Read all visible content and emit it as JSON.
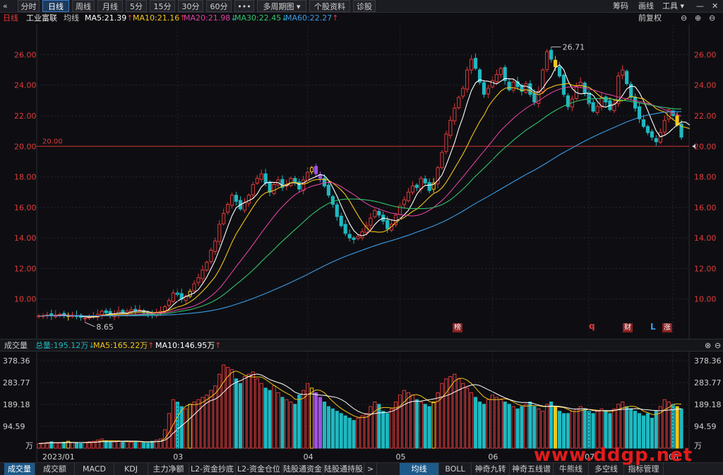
{
  "toolbar": {
    "back_icon": "«",
    "tabs": [
      {
        "label": "分时"
      },
      {
        "label": "日线"
      },
      {
        "label": "周线"
      },
      {
        "label": "月线"
      },
      {
        "label": "5分"
      },
      {
        "label": "15分"
      },
      {
        "label": "30分"
      },
      {
        "label": "60分"
      },
      {
        "label": "•••"
      },
      {
        "label": "多周期图"
      },
      {
        "label": "个股资料"
      },
      {
        "label": "诊股"
      }
    ],
    "active_tab": "日线",
    "right": {
      "chips": "筹码",
      "draw": "画线",
      "tools": "工具"
    }
  },
  "indicator": {
    "period": "日线",
    "name": "工业富联",
    "ma_label": "均线",
    "ma5": "MA5:21.39",
    "ma10": "MA10:21.16",
    "ma20": "MA20:21.98",
    "ma30": "MA30:22.45",
    "ma60": "MA60:22.27",
    "adjust": "前复权"
  },
  "colors": {
    "up": "#e03a3a",
    "down": "#1fb8c0",
    "ma5": "#ffffff",
    "ma10": "#f5c518",
    "ma20": "#e040a0",
    "ma30": "#33c36b",
    "ma60": "#3a9be8",
    "grid": "#262830",
    "accent": "#3b78c2"
  },
  "markers": {
    "bang": "榜",
    "q": "q",
    "cai": "财",
    "L": "L",
    "zhang": "涨"
  },
  "chart_data": [
    {
      "type": "candlestick",
      "y_ticks": [
        "26.00",
        "24.00",
        "22.00",
        "20.00",
        "18.00",
        "16.00",
        "14.00",
        "12.00",
        "10.00"
      ],
      "ylim": [
        8.0,
        27.5
      ],
      "x_labels": [
        "03",
        "04",
        "05",
        "06",
        "07",
        "08"
      ],
      "high_annotation": "26.71",
      "low_annotation": "8.65",
      "hline_label": "20.00",
      "hline_value": 20.0,
      "closes": [
        8.9,
        8.9,
        8.95,
        8.9,
        8.95,
        9.0,
        8.95,
        8.9,
        8.9,
        8.85,
        8.8,
        8.75,
        8.8,
        8.9,
        9.0,
        9.2,
        9.1,
        8.9,
        9.0,
        9.2,
        9.1,
        9.2,
        9.3,
        9.2,
        9.3,
        9.1,
        9.0,
        9.0,
        9.1,
        9.2,
        9.5,
        9.9,
        10.4,
        10.3,
        10.0,
        10.2,
        10.5,
        11.0,
        11.4,
        11.9,
        12.4,
        13.2,
        13.8,
        14.9,
        15.6,
        16.2,
        16.8,
        16.4,
        15.9,
        16.3,
        16.8,
        17.5,
        17.9,
        18.2,
        17.6,
        17.0,
        17.5,
        17.8,
        17.3,
        17.5,
        17.9,
        17.6,
        17.2,
        17.8,
        18.3,
        18.6,
        18.2,
        17.9,
        17.4,
        16.8,
        16.2,
        15.4,
        14.8,
        14.3,
        14.0,
        13.9,
        14.1,
        14.4,
        14.8,
        15.3,
        15.8,
        15.5,
        15.1,
        14.6,
        14.9,
        15.5,
        16.1,
        16.5,
        17.0,
        17.4,
        17.3,
        17.9,
        17.6,
        17.1,
        17.6,
        18.6,
        19.6,
        20.8,
        21.7,
        22.5,
        23.2,
        23.8,
        25.0,
        25.7,
        25.1,
        24.2,
        23.4,
        23.8,
        24.3,
        24.7,
        25.1,
        24.3,
        23.7,
        24.2,
        23.9,
        23.6,
        24.1,
        23.4,
        22.9,
        23.6,
        25.0,
        26.2,
        25.7,
        25.2,
        24.6,
        23.4,
        22.6,
        23.1,
        23.9,
        24.2,
        23.5,
        22.8,
        22.3,
        22.6,
        23.2,
        22.9,
        22.4,
        22.8,
        24.6,
        25.0,
        24.1,
        23.2,
        22.5,
        21.8,
        21.3,
        20.9,
        20.6,
        20.3,
        20.9,
        21.7,
        22.4,
        22.0,
        21.4,
        20.6
      ],
      "volumes": [
        20,
        22,
        25,
        28,
        24,
        22,
        26,
        30,
        24,
        22,
        20,
        25,
        28,
        30,
        35,
        40,
        30,
        26,
        28,
        32,
        30,
        28,
        26,
        30,
        28,
        24,
        22,
        30,
        35,
        40,
        80,
        150,
        210,
        200,
        180,
        170,
        190,
        200,
        210,
        220,
        230,
        250,
        270,
        320,
        360,
        350,
        340,
        300,
        280,
        310,
        320,
        330,
        300,
        280,
        260,
        250,
        270,
        240,
        220,
        210,
        200,
        190,
        230,
        250,
        280,
        260,
        240,
        220,
        200,
        180,
        170,
        160,
        150,
        140,
        130,
        120,
        130,
        140,
        150,
        180,
        200,
        190,
        160,
        150,
        170,
        200,
        230,
        250,
        240,
        230,
        210,
        200,
        190,
        180,
        200,
        240,
        280,
        300,
        310,
        320,
        300,
        280,
        260,
        240,
        220,
        200,
        190,
        210,
        230,
        220,
        210,
        200,
        190,
        180,
        170,
        180,
        190,
        200,
        180,
        170,
        160,
        190,
        200,
        180,
        160,
        150,
        150,
        160,
        170,
        180,
        170,
        160,
        150,
        160,
        170,
        160,
        150,
        170,
        190,
        200,
        180,
        170,
        160,
        150,
        140,
        150,
        130,
        160,
        180,
        210,
        200,
        190,
        180,
        170
      ],
      "ma5": [
        8.9,
        8.9,
        8.92,
        8.91,
        8.92,
        8.94,
        8.95,
        8.94,
        8.92,
        8.92,
        8.88,
        8.84,
        8.82,
        8.82,
        8.85,
        8.93,
        8.98,
        9.02,
        9.04,
        9.08,
        9.08,
        9.08,
        9.16,
        9.2,
        9.22,
        9.22,
        9.18,
        9.12,
        9.1,
        9.08,
        9.16,
        9.34,
        9.62,
        9.86,
        10.02,
        10.16,
        10.28,
        10.4,
        10.62,
        11.0,
        11.44,
        11.98,
        12.54,
        13.24,
        13.98,
        14.74,
        15.46,
        15.98,
        16.18,
        16.32,
        16.44,
        16.58,
        16.88,
        17.34,
        17.6,
        17.64,
        17.64,
        17.62,
        17.44,
        17.42,
        17.6,
        17.62,
        17.5,
        17.6,
        17.76,
        17.9,
        18.02,
        18.16,
        18.08,
        17.78,
        17.3,
        16.74,
        16.12,
        15.5,
        14.94,
        14.48,
        14.22,
        14.14,
        14.24,
        14.5,
        14.88,
        15.16,
        15.3,
        15.26,
        15.18,
        15.12,
        15.24,
        15.52,
        15.8,
        16.3,
        16.86,
        17.22,
        17.44,
        17.46,
        17.5,
        17.76,
        18.12,
        18.76,
        19.5,
        20.24,
        21.16,
        21.92,
        22.84,
        23.64,
        24.16,
        24.36,
        24.28,
        24.26,
        24.18,
        24.08,
        24.26,
        24.44,
        24.42,
        24.4,
        24.2,
        23.94,
        23.94,
        23.84,
        23.58,
        23.52,
        23.8,
        24.22,
        24.56,
        25.14,
        25.34,
        25.02,
        24.3,
        23.78,
        23.52,
        23.44,
        23.46,
        23.5,
        23.34,
        22.94,
        22.64,
        22.56,
        22.68,
        22.72,
        22.98,
        23.34,
        23.76,
        23.94,
        23.9,
        23.52,
        22.98,
        22.34,
        21.66,
        21.02,
        20.62,
        20.72,
        20.9,
        21.16,
        21.4,
        21.6,
        21.58,
        21.39
      ],
      "ma10": [
        8.9,
        8.9,
        8.92,
        8.91,
        8.92,
        8.93,
        8.93,
        8.93,
        8.93,
        8.92,
        8.91,
        8.89,
        8.87,
        8.87,
        8.88,
        8.93,
        8.96,
        8.98,
        8.98,
        9.0,
        9.01,
        9.03,
        9.07,
        9.11,
        9.13,
        9.15,
        9.13,
        9.1,
        9.13,
        9.14,
        9.19,
        9.26,
        9.37,
        9.48,
        9.55,
        9.66,
        9.81,
        10.0,
        10.24,
        10.51,
        10.8,
        11.13,
        11.47,
        11.93,
        12.48,
        13.09,
        13.72,
        14.26,
        14.71,
        15.16,
        15.59,
        16.02,
        16.43,
        16.76,
        16.96,
        17.04,
        17.11,
        17.25,
        17.39,
        17.51,
        17.62,
        17.63,
        17.57,
        17.52,
        17.6,
        17.75,
        17.82,
        17.83,
        17.84,
        17.77,
        17.6,
        17.38,
        17.14,
        16.83,
        16.42,
        15.94,
        15.48,
        15.04,
        14.69,
        14.42,
        14.41,
        14.37,
        14.4,
        14.52,
        14.75,
        15.0,
        15.2,
        15.34,
        15.53,
        15.74,
        15.89,
        16.13,
        16.39,
        16.67,
        16.91,
        17.04,
        17.28,
        17.64,
        18.09,
        18.55,
        19.02,
        19.49,
        20.02,
        20.59,
        21.12,
        21.62,
        22.04,
        22.58,
        22.98,
        23.3,
        23.61,
        23.8,
        23.84,
        23.83,
        23.78,
        23.65,
        23.7,
        23.64,
        23.49,
        23.38,
        23.49,
        23.76,
        23.87,
        23.98,
        24.04,
        24.06,
        24.12,
        24.0,
        23.96,
        23.98,
        23.92,
        23.86,
        23.68,
        23.42,
        23.2,
        23.1,
        23.15,
        23.03,
        22.98,
        22.98,
        23.1,
        23.29,
        23.21,
        23.15,
        23.12,
        22.9,
        22.72,
        22.47,
        22.33,
        22.26,
        21.98,
        21.76,
        21.56,
        21.31,
        21.24,
        21.16
      ],
      "ma20": [
        8.9,
        8.9,
        8.91,
        8.91,
        8.91,
        8.92,
        8.92,
        8.92,
        8.92,
        8.92,
        8.91,
        8.9,
        8.9,
        8.9,
        8.9,
        8.91,
        8.92,
        8.92,
        8.92,
        8.93,
        8.94,
        8.95,
        8.97,
        8.99,
        9.01,
        9.03,
        9.05,
        9.06,
        9.08,
        9.1,
        9.12,
        9.16,
        9.22,
        9.29,
        9.34,
        9.4,
        9.47,
        9.55,
        9.68,
        9.82,
        9.99,
        10.19,
        10.42,
        10.7,
        11.03,
        11.39,
        11.76,
        12.13,
        12.48,
        12.84,
        13.2,
        13.57,
        13.95,
        14.34,
        14.7,
        15.06,
        15.42,
        15.76,
        16.05,
        16.33,
        16.6,
        16.83,
        17.0,
        17.14,
        17.28,
        17.39,
        17.46,
        17.53,
        17.61,
        17.64,
        17.61,
        17.5,
        17.36,
        17.18,
        17.01,
        16.84,
        16.65,
        16.43,
        16.26,
        16.1,
        15.99,
        15.9,
        15.79,
        15.7,
        15.62,
        15.59,
        15.53,
        15.49,
        15.46,
        15.44,
        15.47,
        15.55,
        15.66,
        15.81,
        16.0,
        16.22,
        16.45,
        16.72,
        17.03,
        17.35,
        17.68,
        18.0,
        18.34,
        18.68,
        19.02,
        19.36,
        19.68,
        20.02,
        20.36,
        20.7,
        21.03,
        21.31,
        21.57,
        21.83,
        22.07,
        22.28,
        22.48,
        22.66,
        22.82,
        22.98,
        23.16,
        23.34,
        23.5,
        23.64,
        23.74,
        23.82,
        23.88,
        23.89,
        23.88,
        23.85,
        23.81,
        23.75,
        23.68,
        23.62,
        23.52,
        23.43,
        23.38,
        23.3,
        23.22,
        23.16,
        23.1,
        23.04,
        22.98,
        22.93,
        22.88,
        22.8,
        22.72,
        22.62,
        22.52,
        22.4,
        22.3,
        22.18,
        22.06,
        21.98
      ],
      "ma30": [
        8.9,
        8.9,
        8.9,
        8.9,
        8.9,
        8.9,
        8.9,
        8.9,
        8.9,
        8.9,
        8.9,
        8.9,
        8.9,
        8.9,
        8.9,
        8.9,
        8.91,
        8.91,
        8.91,
        8.92,
        8.92,
        8.93,
        8.94,
        8.95,
        8.96,
        8.97,
        8.98,
        8.99,
        9.0,
        9.01,
        9.04,
        9.07,
        9.12,
        9.17,
        9.21,
        9.26,
        9.31,
        9.38,
        9.46,
        9.55,
        9.66,
        9.78,
        9.92,
        10.09,
        10.29,
        10.5,
        10.73,
        10.96,
        11.18,
        11.41,
        11.65,
        11.9,
        12.17,
        12.45,
        12.72,
        12.98,
        13.25,
        13.53,
        13.79,
        14.04,
        14.3,
        14.55,
        14.79,
        15.04,
        15.29,
        15.53,
        15.74,
        15.94,
        16.11,
        16.26,
        16.38,
        16.46,
        16.51,
        16.54,
        16.55,
        16.55,
        16.54,
        16.52,
        16.49,
        16.45,
        16.4,
        16.34,
        16.26,
        16.19,
        16.11,
        16.05,
        16.0,
        15.96,
        15.93,
        15.92,
        15.92,
        15.92,
        15.93,
        15.95,
        16.0,
        16.08,
        16.18,
        16.32,
        16.5,
        16.71,
        16.95,
        17.2,
        17.47,
        17.77,
        18.05,
        18.31,
        18.57,
        18.84,
        19.12,
        19.4,
        19.67,
        19.92,
        20.15,
        20.4,
        20.63,
        20.84,
        21.05,
        21.24,
        21.42,
        21.6,
        21.8,
        22.0,
        22.18,
        22.35,
        22.5,
        22.64,
        22.76,
        22.86,
        22.95,
        23.02,
        23.07,
        23.1,
        23.12,
        23.13,
        23.13,
        23.12,
        23.1,
        23.08,
        23.05,
        23.02,
        22.98,
        22.94,
        22.89,
        22.84,
        22.79,
        22.74,
        22.68,
        22.63,
        22.58,
        22.54,
        22.5,
        22.47,
        22.45,
        22.45
      ],
      "ma60": [
        8.9,
        8.9,
        8.9,
        8.9,
        8.9,
        8.9,
        8.9,
        8.9,
        8.9,
        8.9,
        8.9,
        8.9,
        8.9,
        8.9,
        8.9,
        8.9,
        8.9,
        8.9,
        8.9,
        8.9,
        8.9,
        8.91,
        8.91,
        8.91,
        8.92,
        8.92,
        8.92,
        8.93,
        8.93,
        8.94,
        8.95,
        8.96,
        8.98,
        9.0,
        9.02,
        9.04,
        9.06,
        9.09,
        9.12,
        9.15,
        9.19,
        9.24,
        9.29,
        9.35,
        9.42,
        9.49,
        9.57,
        9.66,
        9.75,
        9.84,
        9.94,
        10.04,
        10.15,
        10.26,
        10.37,
        10.48,
        10.6,
        10.72,
        10.84,
        10.96,
        11.09,
        11.22,
        11.35,
        11.48,
        11.62,
        11.76,
        11.9,
        12.04,
        12.18,
        12.31,
        12.44,
        12.56,
        12.68,
        12.79,
        12.9,
        13.0,
        13.1,
        13.2,
        13.3,
        13.4,
        13.49,
        13.58,
        13.67,
        13.75,
        13.83,
        13.91,
        14.0,
        14.09,
        14.18,
        14.28,
        14.38,
        14.48,
        14.58,
        14.68,
        14.79,
        14.91,
        15.03,
        15.16,
        15.3,
        15.45,
        15.6,
        15.76,
        15.93,
        16.1,
        16.26,
        16.42,
        16.57,
        16.72,
        16.88,
        17.04,
        17.2,
        17.36,
        17.52,
        17.68,
        17.84,
        18.0,
        18.15,
        18.3,
        18.44,
        18.6,
        18.76,
        18.93,
        19.1,
        19.27,
        19.44,
        19.6,
        19.75,
        19.9,
        20.05,
        20.2,
        20.34,
        20.48,
        20.62,
        20.75,
        20.88,
        21.0,
        21.12,
        21.24,
        21.36,
        21.48,
        21.6,
        21.7,
        21.8,
        21.9,
        21.98,
        22.05,
        22.1,
        22.15,
        22.2,
        22.23,
        22.25,
        22.26,
        22.27,
        22.27
      ]
    },
    {
      "type": "bar",
      "label": "成交量",
      "total": "总量:195.12万",
      "ma5": "MA5:165.22万",
      "ma10": "MA10:146.95万",
      "y_ticks": [
        "378.36",
        "283.77",
        "189.18",
        "94.59"
      ],
      "unit": "万",
      "ylim": [
        0,
        400
      ],
      "x_labels": [
        "2023/01",
        "03",
        "04",
        "05",
        "06",
        "07",
        "08"
      ]
    }
  ],
  "bottom_tabs": [
    {
      "label": "成交量"
    },
    {
      "label": "成交额"
    },
    {
      "label": "MACD"
    },
    {
      "label": "KDJ"
    },
    {
      "label": "主力净额"
    },
    {
      "label": "L2-资金抄底"
    },
    {
      "label": "L2-资金仓位"
    },
    {
      "label": "陆股通资金"
    },
    {
      "label": "陆股通持股"
    },
    {
      "label": ">"
    },
    {
      "label": "均线"
    },
    {
      "label": "BOLL"
    },
    {
      "label": "神奇九转"
    },
    {
      "label": "神奇五线谱"
    },
    {
      "label": "牛熊线"
    },
    {
      "label": "多空线"
    },
    {
      "label": "指标管理"
    }
  ],
  "watermark": "www.ddgp.net"
}
